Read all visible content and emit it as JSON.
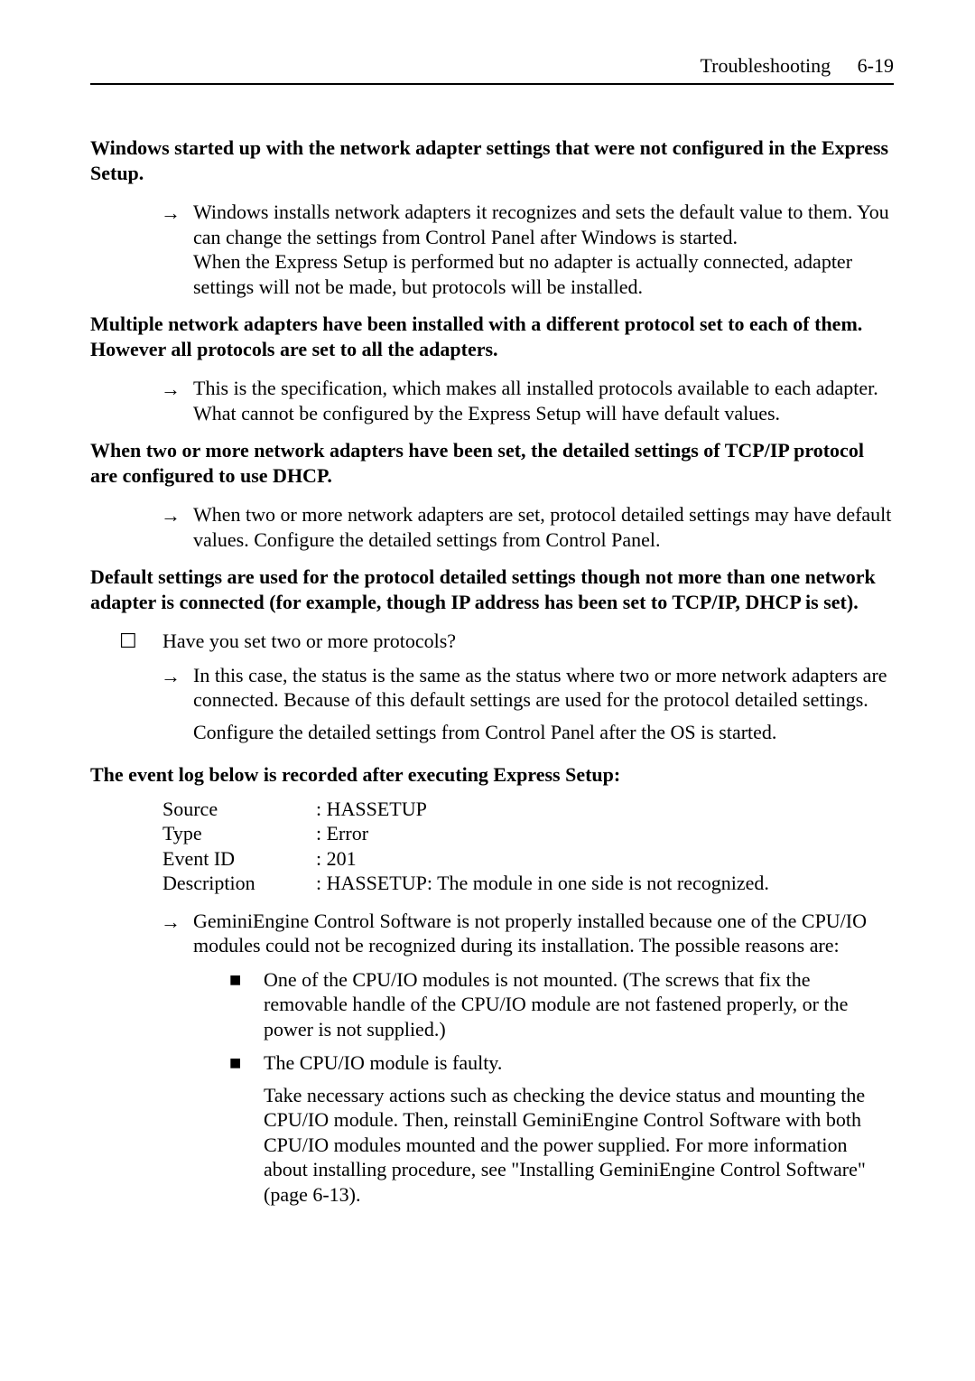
{
  "header": {
    "title": "Troubleshooting",
    "chapter": "6-19"
  },
  "marks": {
    "arrow": "→",
    "checkbox": "☐",
    "bullet": "■"
  },
  "sections": {
    "s1": {
      "heading": "Windows started up with the network adapter settings that were not configured in the Express Setup.",
      "arrow": "Windows installs network adapters it recognizes and sets the default value to them. You can change the settings from Control Panel after Windows is started.\nWhen the Express Setup is performed but no adapter is actually connected, adapter settings will not be made, but protocols will be installed."
    },
    "s2": {
      "heading": "Multiple network adapters have been installed with a different protocol set to each of them. However all protocols are set to all the adapters.",
      "arrow": "This is the specification, which makes all installed protocols available to each adapter. What cannot be configured by the Express Setup will have default values."
    },
    "s3": {
      "heading": "When two or more network adapters have been set, the detailed settings of TCP/IP protocol are configured to use DHCP.",
      "arrow": "When two or more network adapters are set, protocol detailed settings may have default values. Configure the detailed settings from Control Panel."
    },
    "s4": {
      "heading": "Default settings are used for the protocol detailed settings though not more than one network adapter is connected (for example, though IP address has been set to TCP/IP, DHCP is set).",
      "checkbox": "Have you set two or more protocols?",
      "arrow": "In this case, the status is the same as the status where two or more network adapters are connected. Because of this default settings are used for the protocol detailed settings.",
      "after": "Configure the detailed settings from Control Panel after the OS is started."
    },
    "s5": {
      "heading": "The event log below is recorded after executing Express Setup:",
      "log": {
        "source": {
          "k": "Source",
          "v": ": HASSETUP"
        },
        "type": {
          "k": "Type",
          "v": ": Error"
        },
        "eventid": {
          "k": "Event ID",
          "v": ": 201"
        },
        "desc": {
          "k": "Description",
          "v": ": HASSETUP: The module in one side is not recognized."
        }
      },
      "arrow": "GeminiEngine Control Software is not properly installed because one of the CPU/IO modules could not be recognized during its installation. The possible reasons are:",
      "bullets": {
        "b1": "One of the CPU/IO modules is not mounted. (The screws that fix the removable handle of the CPU/IO module are not fastened properly, or the power is not supplied.)",
        "b2": "The CPU/IO module is faulty."
      },
      "after": "Take necessary actions such as checking the device status and mounting the CPU/IO module. Then, reinstall GeminiEngine Control Software with both CPU/IO modules mounted and the power supplied. For more information about installing procedure, see \"Installing GeminiEngine Control Software\" (page 6-13)."
    }
  }
}
